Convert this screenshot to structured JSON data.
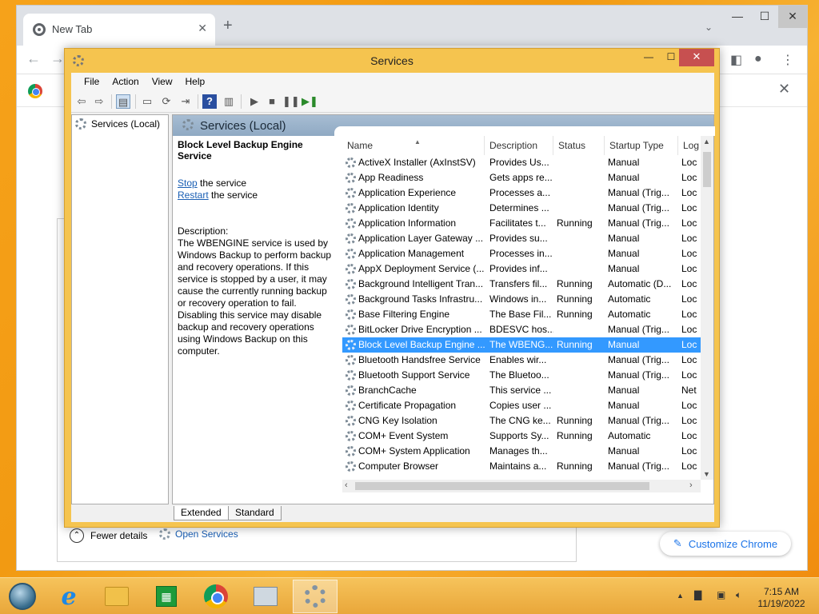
{
  "chrome": {
    "tab_title": "New Tab",
    "tab_close": "✕",
    "new_tab": "+",
    "tab_search": "⌄",
    "minimize": "—",
    "maximize": "☐",
    "close": "✕",
    "back": "←",
    "forward": "→",
    "content_close": "✕",
    "fewer_details": "Fewer details",
    "open_services": "Open Services",
    "customize_chrome": "Customize Chrome"
  },
  "services_window": {
    "title": "Services",
    "minimize": "—",
    "maximize": "☐",
    "close": "✕",
    "menu": [
      "File",
      "Action",
      "View",
      "Help"
    ],
    "tree_item": "Services (Local)",
    "header_title": "Services (Local)",
    "selected_service_title": "Block Level Backup Engine Service",
    "stop_link": "Stop",
    "stop_suffix": " the service",
    "restart_link": "Restart",
    "restart_suffix": " the service",
    "description_label": "Description:",
    "description_text": "The WBENGINE service is used by Windows Backup to perform backup and recovery operations. If this service is stopped by a user, it may cause the currently running backup or recovery operation to fail. Disabling this service may disable backup and recovery operations using Windows Backup on this computer.",
    "columns": [
      "Name",
      "Description",
      "Status",
      "Startup Type",
      "Log"
    ],
    "rows": [
      {
        "name": "ActiveX Installer (AxInstSV)",
        "desc": "Provides Us...",
        "status": "",
        "startup": "Manual",
        "log": "Loc"
      },
      {
        "name": "App Readiness",
        "desc": "Gets apps re...",
        "status": "",
        "startup": "Manual",
        "log": "Loc"
      },
      {
        "name": "Application Experience",
        "desc": "Processes a...",
        "status": "",
        "startup": "Manual (Trig...",
        "log": "Loc"
      },
      {
        "name": "Application Identity",
        "desc": "Determines ...",
        "status": "",
        "startup": "Manual (Trig...",
        "log": "Loc"
      },
      {
        "name": "Application Information",
        "desc": "Facilitates t...",
        "status": "Running",
        "startup": "Manual (Trig...",
        "log": "Loc"
      },
      {
        "name": "Application Layer Gateway ...",
        "desc": "Provides su...",
        "status": "",
        "startup": "Manual",
        "log": "Loc"
      },
      {
        "name": "Application Management",
        "desc": "Processes in...",
        "status": "",
        "startup": "Manual",
        "log": "Loc"
      },
      {
        "name": "AppX Deployment Service (...",
        "desc": "Provides inf...",
        "status": "",
        "startup": "Manual",
        "log": "Loc"
      },
      {
        "name": "Background Intelligent Tran...",
        "desc": "Transfers fil...",
        "status": "Running",
        "startup": "Automatic (D...",
        "log": "Loc"
      },
      {
        "name": "Background Tasks Infrastru...",
        "desc": "Windows in...",
        "status": "Running",
        "startup": "Automatic",
        "log": "Loc"
      },
      {
        "name": "Base Filtering Engine",
        "desc": "The Base Fil...",
        "status": "Running",
        "startup": "Automatic",
        "log": "Loc"
      },
      {
        "name": "BitLocker Drive Encryption ...",
        "desc": "BDESVC hos...",
        "status": "",
        "startup": "Manual (Trig...",
        "log": "Loc"
      },
      {
        "name": "Block Level Backup Engine ...",
        "desc": "The WBENG...",
        "status": "Running",
        "startup": "Manual",
        "log": "Loc"
      },
      {
        "name": "Bluetooth Handsfree Service",
        "desc": "Enables wir...",
        "status": "",
        "startup": "Manual (Trig...",
        "log": "Loc"
      },
      {
        "name": "Bluetooth Support Service",
        "desc": "The Bluetoo...",
        "status": "",
        "startup": "Manual (Trig...",
        "log": "Loc"
      },
      {
        "name": "BranchCache",
        "desc": "This service ...",
        "status": "",
        "startup": "Manual",
        "log": "Net"
      },
      {
        "name": "Certificate Propagation",
        "desc": "Copies user ...",
        "status": "",
        "startup": "Manual",
        "log": "Loc"
      },
      {
        "name": "CNG Key Isolation",
        "desc": "The CNG ke...",
        "status": "Running",
        "startup": "Manual (Trig...",
        "log": "Loc"
      },
      {
        "name": "COM+ Event System",
        "desc": "Supports Sy...",
        "status": "Running",
        "startup": "Automatic",
        "log": "Loc"
      },
      {
        "name": "COM+ System Application",
        "desc": "Manages th...",
        "status": "",
        "startup": "Manual",
        "log": "Loc"
      },
      {
        "name": "Computer Browser",
        "desc": "Maintains a...",
        "status": "Running",
        "startup": "Manual (Trig...",
        "log": "Loc"
      }
    ],
    "selected_index": 12,
    "tabs": [
      "Extended",
      "Standard"
    ]
  },
  "taskbar": {
    "time": "7:15 AM",
    "date": "11/19/2022",
    "store_glyph": "▦",
    "ie_glyph": "e"
  },
  "colors": {
    "selection": "#3399ff",
    "window_frame": "#f5c44f",
    "close_button": "#c75050"
  }
}
